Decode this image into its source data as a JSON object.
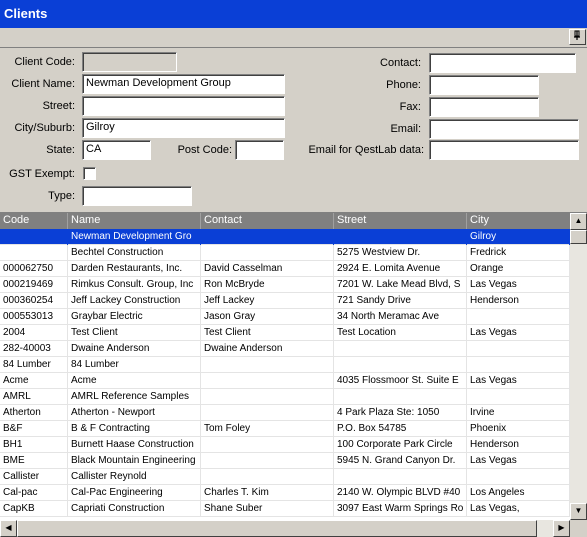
{
  "title": "Clients",
  "form": {
    "client_code_label": "Client Code:",
    "client_code_value": "",
    "client_name_label": "Client Name:",
    "client_name_value": "Newman Development Group",
    "street_label": "Street:",
    "street_value": "",
    "city_label": "City/Suburb:",
    "city_value": "Gilroy",
    "state_label": "State:",
    "state_value": "CA",
    "postcode_label": "Post Code:",
    "postcode_value": "",
    "gst_label": "GST Exempt:",
    "type_label": "Type:",
    "type_value": "",
    "contact_label": "Contact:",
    "contact_value": "",
    "phone_label": "Phone:",
    "phone_value": "",
    "fax_label": "Fax:",
    "fax_value": "",
    "email_label": "Email:",
    "email_value": "",
    "qestlab_email_label": "Email for QestLab data:",
    "qestlab_email_value": ""
  },
  "grid": {
    "columns": [
      "Code",
      "Name",
      "Contact",
      "Street",
      "City"
    ],
    "rows": [
      [
        "",
        "Newman Development Gro",
        "",
        "",
        "Gilroy"
      ],
      [
        "",
        "Bechtel Construction",
        "",
        "5275 Westview Dr.",
        "Fredrick"
      ],
      [
        "000062750",
        "Darden Restaurants, Inc.",
        "David Casselman",
        "2924 E. Lomita Avenue",
        "Orange"
      ],
      [
        "000219469",
        "Rimkus Consult. Group, Inc",
        "Ron McBryde",
        "7201 W. Lake Mead Blvd, S",
        "Las Vegas"
      ],
      [
        "000360254",
        "Jeff Lackey Construction",
        "Jeff Lackey",
        "721 Sandy Drive",
        "Henderson"
      ],
      [
        "000553013",
        "Graybar Electric",
        "Jason Gray",
        "34 North Meramac Ave",
        ""
      ],
      [
        "2004",
        "Test Client",
        "Test Client",
        "Test Location",
        "Las Vegas"
      ],
      [
        "282-40003",
        "Dwaine Anderson",
        "Dwaine Anderson",
        "",
        ""
      ],
      [
        "84 Lumber",
        "84 Lumber",
        "",
        "",
        ""
      ],
      [
        "Acme",
        "Acme",
        "",
        "4035 Flossmoor St.  Suite E",
        "Las Vegas"
      ],
      [
        "AMRL",
        "AMRL Reference Samples",
        "",
        "",
        ""
      ],
      [
        "Atherton",
        "Atherton - Newport",
        "",
        "4 Park Plaza Ste: 1050",
        "Irvine"
      ],
      [
        "B&F",
        "B & F Contracting",
        "Tom Foley",
        "P.O. Box 54785",
        "Phoenix"
      ],
      [
        "BH1",
        "Burnett Haase Construction",
        "",
        "100 Corporate Park Circle",
        "Henderson"
      ],
      [
        "BME",
        "Black Mountain Engineering",
        "",
        "5945 N. Grand Canyon Dr.",
        "Las Vegas"
      ],
      [
        "Callister",
        "Callister Reynold",
        "",
        "",
        ""
      ],
      [
        "Cal-pac",
        "Cal-Pac Engineering",
        "Charles T. Kim",
        "2140 W. Olympic BLVD #40",
        "Los Angeles"
      ],
      [
        "CapKB",
        "Capriati Construction",
        "Shane Suber",
        "3097 East Warm Springs Ro",
        "Las Vegas,"
      ]
    ],
    "selected_row": 0
  }
}
